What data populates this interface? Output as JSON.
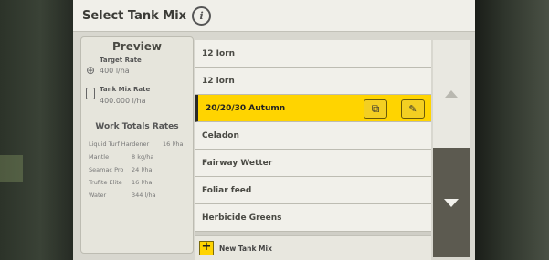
{
  "header": {
    "title": "Select Tank Mix",
    "info_icon": "info-icon"
  },
  "preview": {
    "title": "Preview",
    "target_rate_label": "Target Rate",
    "target_rate_value": "400 l/ha",
    "tank_mix_rate_label": "Tank Mix Rate",
    "tank_mix_rate_value": "400.000 l/ha",
    "work_totals_title": "Work Totals Rates",
    "rates": [
      {
        "name": "Liquid Turf Hardener",
        "rate": "16 l/ha"
      },
      {
        "name": "Mantle",
        "rate": "8 kg/ha"
      },
      {
        "name": "Seamac Pro",
        "rate": "24 l/ha"
      },
      {
        "name": "Trufite Elite",
        "rate": "16 l/ha"
      },
      {
        "name": "Water",
        "rate": "344 l/ha"
      }
    ]
  },
  "tank_mixes": {
    "items": [
      {
        "label": "12 Iorn"
      },
      {
        "label": "12 lorn"
      },
      {
        "label": "20/20/30 Autumn",
        "selected": true
      },
      {
        "label": "Celadon"
      },
      {
        "label": "Fairway Wetter"
      },
      {
        "label": "Foliar feed"
      },
      {
        "label": "Herbicide Greens"
      }
    ],
    "new_button_label": "New Tank Mix"
  },
  "colors": {
    "selected": "#ffd400",
    "accent_border": "#2a2a26"
  },
  "icons": [
    "info-icon",
    "crosshair-icon",
    "tank-icon",
    "copy-icon",
    "pencil-icon",
    "plus-icon",
    "scroll-up-icon",
    "scroll-down-icon"
  ]
}
